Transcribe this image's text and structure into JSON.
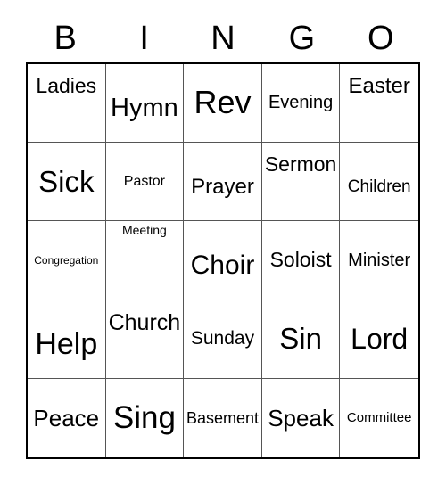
{
  "card": {
    "title": "BINGO",
    "header_letters": [
      "B",
      "I",
      "N",
      "G",
      "O"
    ],
    "grid_columns": 5,
    "grid_rows": 5,
    "border_color": "#000000",
    "grid_line_color": "#555555",
    "text_color": "#000000",
    "background_color": "#ffffff",
    "cells": [
      {
        "text": "Ladies",
        "size": 23,
        "align": "upper",
        "row": 1,
        "col": 1
      },
      {
        "text": "Hymn",
        "size": 29,
        "align": "lower",
        "row": 1,
        "col": 2
      },
      {
        "text": "Rev",
        "size": 36,
        "align": "middle",
        "row": 1,
        "col": 3
      },
      {
        "text": "Evening",
        "size": 20,
        "align": "middle",
        "row": 1,
        "col": 4
      },
      {
        "text": "Easter",
        "size": 24,
        "align": "upper",
        "row": 1,
        "col": 5
      },
      {
        "text": "Sick",
        "size": 33,
        "align": "middle",
        "row": 2,
        "col": 1
      },
      {
        "text": "Pastor",
        "size": 16,
        "align": "middle",
        "row": 2,
        "col": 2
      },
      {
        "text": "Prayer",
        "size": 24,
        "align": "lower",
        "row": 2,
        "col": 3
      },
      {
        "text": "Sermon",
        "size": 23,
        "align": "upper",
        "row": 2,
        "col": 4
      },
      {
        "text": "Children",
        "size": 19,
        "align": "lower",
        "row": 2,
        "col": 5
      },
      {
        "text": "Congregation",
        "size": 12,
        "align": "middle",
        "row": 3,
        "col": 1
      },
      {
        "text": "Meeting",
        "size": 14,
        "align": "top",
        "row": 3,
        "col": 2
      },
      {
        "text": "Choir",
        "size": 30,
        "align": "lower",
        "row": 3,
        "col": 3
      },
      {
        "text": "Soloist",
        "size": 23,
        "align": "middle",
        "row": 3,
        "col": 4
      },
      {
        "text": "Minister",
        "size": 20,
        "align": "middle",
        "row": 3,
        "col": 5
      },
      {
        "text": "Help",
        "size": 34,
        "align": "lower",
        "row": 4,
        "col": 1
      },
      {
        "text": "Church",
        "size": 25,
        "align": "upper",
        "row": 4,
        "col": 2
      },
      {
        "text": "Sunday",
        "size": 21,
        "align": "middle",
        "row": 4,
        "col": 3
      },
      {
        "text": "Sin",
        "size": 33,
        "align": "middle",
        "row": 4,
        "col": 4
      },
      {
        "text": "Lord",
        "size": 32,
        "align": "middle",
        "row": 4,
        "col": 5
      },
      {
        "text": "Peace",
        "size": 26,
        "align": "middle",
        "row": 5,
        "col": 1
      },
      {
        "text": "Sing",
        "size": 35,
        "align": "middle",
        "row": 5,
        "col": 2
      },
      {
        "text": "Basement",
        "size": 18,
        "align": "middle",
        "row": 5,
        "col": 3
      },
      {
        "text": "Speak",
        "size": 26,
        "align": "middle",
        "row": 5,
        "col": 4
      },
      {
        "text": "Committee",
        "size": 15,
        "align": "middle",
        "row": 5,
        "col": 5
      }
    ]
  }
}
